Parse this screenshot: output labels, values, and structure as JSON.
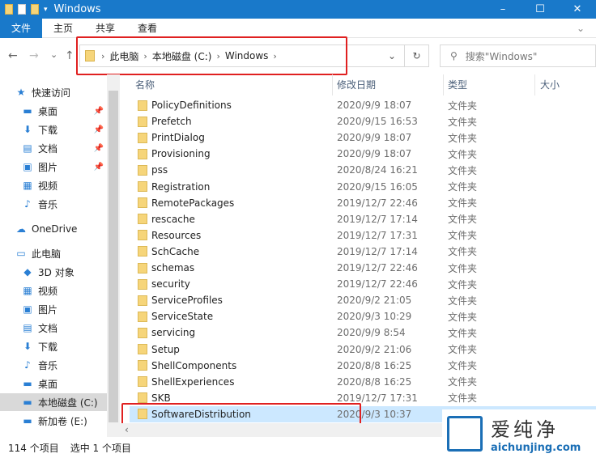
{
  "window": {
    "title": "Windows",
    "minimize": "–",
    "maximize": "☐",
    "close": "✕"
  },
  "ribbon": {
    "tabs": [
      "文件",
      "主页",
      "共享",
      "查看"
    ]
  },
  "nav": {
    "back": "←",
    "forward": "→",
    "recent": "⌄",
    "up": "↑"
  },
  "address": {
    "crumbs": [
      "此电脑",
      "本地磁盘 (C:)",
      "Windows"
    ],
    "refresh": "↻",
    "dropdown": "⌄"
  },
  "search": {
    "placeholder": "搜索\"Windows\""
  },
  "sidebar": [
    {
      "label": "快速访问",
      "icon": "star-icon",
      "glyph": "★",
      "pinned": false
    },
    {
      "label": "桌面",
      "icon": "desktop-icon",
      "glyph": "▬",
      "pinned": true
    },
    {
      "label": "下载",
      "icon": "download-icon",
      "glyph": "⬇",
      "pinned": true
    },
    {
      "label": "文档",
      "icon": "document-icon",
      "glyph": "▤",
      "pinned": true
    },
    {
      "label": "图片",
      "icon": "picture-icon",
      "glyph": "▣",
      "pinned": true
    },
    {
      "label": "视频",
      "icon": "video-icon",
      "glyph": "▦",
      "pinned": false
    },
    {
      "label": "音乐",
      "icon": "music-icon",
      "glyph": "♪",
      "pinned": false
    },
    {
      "label": "OneDrive",
      "icon": "cloud-icon",
      "glyph": "☁",
      "pinned": false
    },
    {
      "label": "此电脑",
      "icon": "computer-icon",
      "glyph": "▭",
      "pinned": false
    },
    {
      "label": "3D 对象",
      "icon": "cube-icon",
      "glyph": "◆",
      "pinned": false
    },
    {
      "label": "视频",
      "icon": "video-icon",
      "glyph": "▦",
      "pinned": false
    },
    {
      "label": "图片",
      "icon": "picture-icon",
      "glyph": "▣",
      "pinned": false
    },
    {
      "label": "文档",
      "icon": "document-icon",
      "glyph": "▤",
      "pinned": false
    },
    {
      "label": "下载",
      "icon": "download-icon",
      "glyph": "⬇",
      "pinned": false
    },
    {
      "label": "音乐",
      "icon": "music-icon",
      "glyph": "♪",
      "pinned": false
    },
    {
      "label": "桌面",
      "icon": "desktop-icon",
      "glyph": "▬",
      "pinned": false
    },
    {
      "label": "本地磁盘 (C:)",
      "icon": "drive-icon",
      "glyph": "▬",
      "pinned": false
    },
    {
      "label": "新加卷 (E:)",
      "icon": "drive-icon",
      "glyph": "▬",
      "pinned": false
    }
  ],
  "columns": {
    "name": "名称",
    "date": "修改日期",
    "type": "类型",
    "size": "大小"
  },
  "files": [
    {
      "name": "PolicyDefinitions",
      "date": "2020/9/9 18:07",
      "type": "文件夹"
    },
    {
      "name": "Prefetch",
      "date": "2020/9/15 16:53",
      "type": "文件夹"
    },
    {
      "name": "PrintDialog",
      "date": "2020/9/9 18:07",
      "type": "文件夹"
    },
    {
      "name": "Provisioning",
      "date": "2020/9/9 18:07",
      "type": "文件夹"
    },
    {
      "name": "pss",
      "date": "2020/8/24 16:21",
      "type": "文件夹"
    },
    {
      "name": "Registration",
      "date": "2020/9/15 16:05",
      "type": "文件夹"
    },
    {
      "name": "RemotePackages",
      "date": "2019/12/7 22:46",
      "type": "文件夹"
    },
    {
      "name": "rescache",
      "date": "2019/12/7 17:14",
      "type": "文件夹"
    },
    {
      "name": "Resources",
      "date": "2019/12/7 17:31",
      "type": "文件夹"
    },
    {
      "name": "SchCache",
      "date": "2019/12/7 17:14",
      "type": "文件夹"
    },
    {
      "name": "schemas",
      "date": "2019/12/7 22:46",
      "type": "文件夹"
    },
    {
      "name": "security",
      "date": "2019/12/7 22:46",
      "type": "文件夹"
    },
    {
      "name": "ServiceProfiles",
      "date": "2020/9/2 21:05",
      "type": "文件夹"
    },
    {
      "name": "ServiceState",
      "date": "2020/9/3 10:29",
      "type": "文件夹"
    },
    {
      "name": "servicing",
      "date": "2020/9/9 8:54",
      "type": "文件夹"
    },
    {
      "name": "Setup",
      "date": "2020/9/2 21:06",
      "type": "文件夹"
    },
    {
      "name": "ShellComponents",
      "date": "2020/8/8 16:25",
      "type": "文件夹"
    },
    {
      "name": "ShellExperiences",
      "date": "2020/8/8 16:25",
      "type": "文件夹"
    },
    {
      "name": "SKB",
      "date": "2019/12/7 17:31",
      "type": "文件夹"
    },
    {
      "name": "SoftwareDistribution",
      "date": "2020/9/3 10:37",
      "type": ""
    }
  ],
  "status": {
    "count": "114 个项目",
    "selected": "选中 1 个项目"
  },
  "watermark": {
    "text": "爱纯净",
    "url": "aichunjing.com"
  }
}
